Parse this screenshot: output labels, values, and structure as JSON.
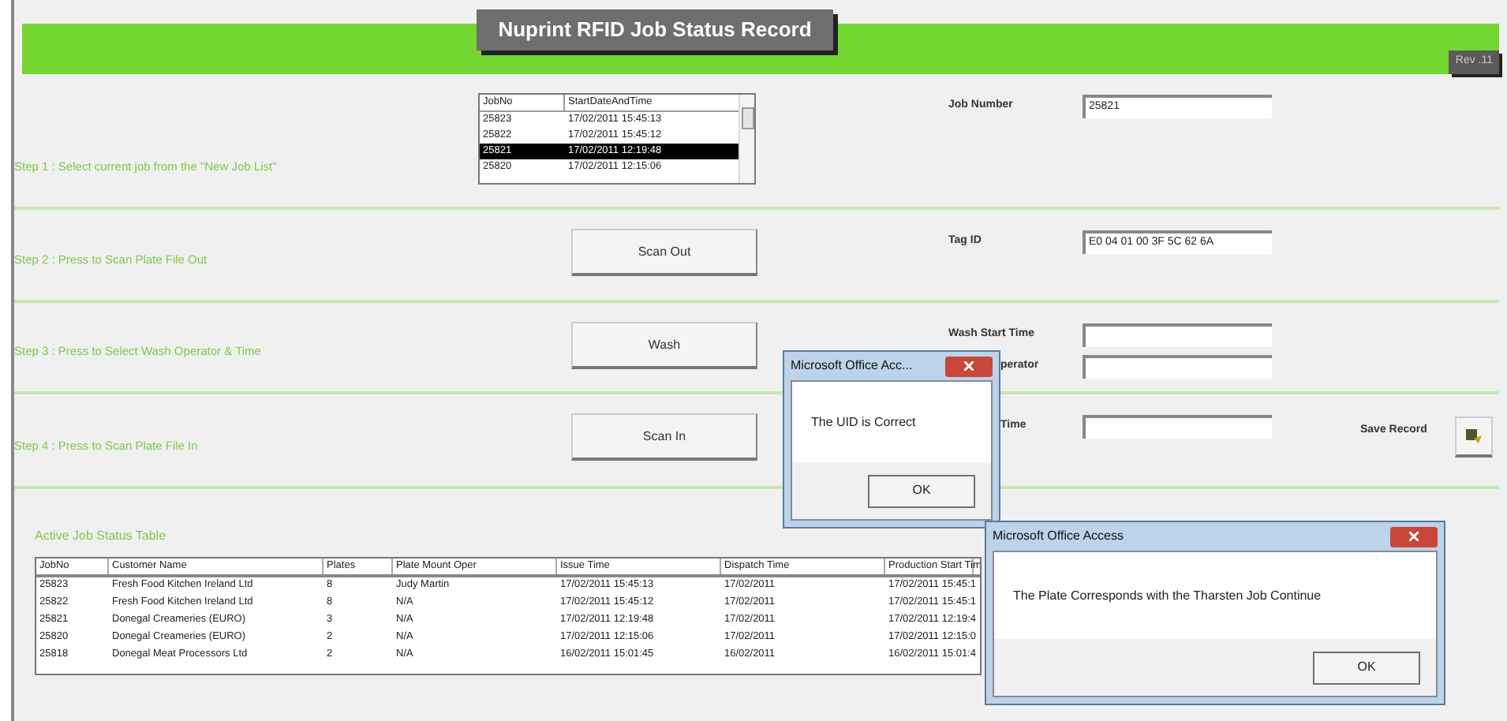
{
  "header": {
    "title": "Nuprint RFID Job Status Record",
    "revision": "Rev .11"
  },
  "job_list": {
    "columns": [
      "JobNo",
      "StartDateAndTime"
    ],
    "rows": [
      {
        "job_no": "25823",
        "start": "17/02/2011 15:45:13",
        "selected": false
      },
      {
        "job_no": "25822",
        "start": "17/02/2011 15:45:12",
        "selected": false
      },
      {
        "job_no": "25821",
        "start": "17/02/2011 12:19:48",
        "selected": true
      },
      {
        "job_no": "25820",
        "start": "17/02/2011 12:15:06",
        "selected": false
      }
    ]
  },
  "sections": [
    {
      "kind": "list",
      "step": "Step 1 : Select current job from the \"New Job List\"",
      "fields": [
        {
          "label": "Job Number",
          "value": "25821",
          "clipped": false
        }
      ]
    },
    {
      "kind": "button",
      "step": "Step 2 : Press to Scan Plate File Out",
      "button": "Scan Out",
      "fields": [
        {
          "label": "Tag ID",
          "value": "E0 04 01 00 3F 5C 62 6A",
          "clipped": false
        }
      ]
    },
    {
      "kind": "button",
      "step": "Step 3 : Press to Select Wash Operator & Time",
      "button": "Wash",
      "fields": [
        {
          "label": "Wash Start Time",
          "clipped": false
        },
        {
          "label": "perator",
          "clipped": true
        }
      ]
    },
    {
      "kind": "button",
      "step": "Step 4 : Press to Scan Plate File In",
      "button": "Scan In",
      "fields": [
        {
          "label": "Time",
          "clipped": true
        }
      ],
      "save": {
        "label": "Save Record"
      }
    }
  ],
  "table": {
    "title": "Active Job Status Table",
    "columns": [
      "JobNo",
      "Customer Name",
      "Plates",
      "Plate Mount Oper",
      "Issue Time",
      "Dispatch Time",
      "Production Start Tim"
    ],
    "rows": [
      [
        "25823",
        "Fresh Food Kitchen Ireland Ltd",
        "8",
        "Judy Martin",
        "17/02/2011 15:45:13",
        "17/02/2011",
        "17/02/2011 15:45:1"
      ],
      [
        "25822",
        "Fresh Food Kitchen Ireland Ltd",
        "8",
        "N/A",
        "17/02/2011 15:45:12",
        "17/02/2011",
        "17/02/2011 15:45:1"
      ],
      [
        "25821",
        "Donegal Creameries (EURO)",
        "3",
        "N/A",
        "17/02/2011 12:19:48",
        "17/02/2011",
        "17/02/2011 12:19:4"
      ],
      [
        "25820",
        "Donegal Creameries (EURO)",
        "2",
        "N/A",
        "17/02/2011 12:15:06",
        "17/02/2011",
        "17/02/2011 12:15:0"
      ],
      [
        "25818",
        "Donegal Meat Processors Ltd",
        "2",
        "N/A",
        "16/02/2011 15:01:45",
        "16/02/2011",
        "16/02/2011 15:01:4"
      ]
    ]
  },
  "dialogs": [
    {
      "title": "Microsoft Office Acc...",
      "message": "The UID is Correct",
      "button": "OK"
    },
    {
      "title": "Microsoft Office Access",
      "message": "The Plate Corresponds with the Tharsten Job Continue",
      "button": "OK"
    }
  ]
}
